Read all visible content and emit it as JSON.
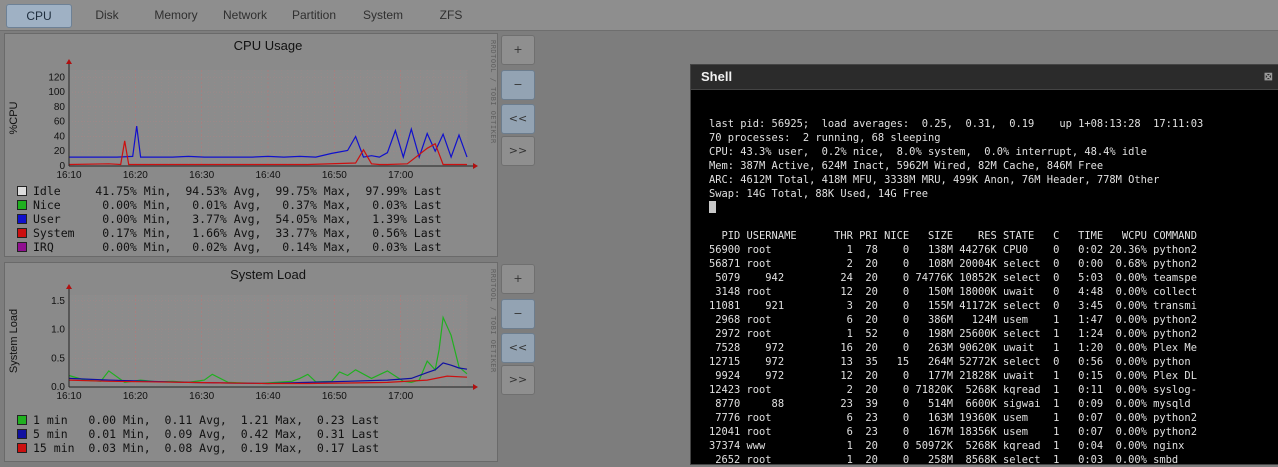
{
  "tabs": [
    {
      "label": "CPU",
      "active": true
    },
    {
      "label": "Disk"
    },
    {
      "label": "Memory"
    },
    {
      "label": "Network"
    },
    {
      "label": "Partition"
    },
    {
      "label": "System"
    },
    {
      "label": "ZFS"
    }
  ],
  "side_tag": "RRDTOOL / TOBI OETIKER",
  "controls": {
    "zoom_in": "+",
    "zoom_out": "−",
    "back": "<<",
    "forward": ">>"
  },
  "cpu_panel": {
    "legend": [
      {
        "name": "Idle",
        "min": "41.75%",
        "avg": "94.53%",
        "max": "99.75%",
        "last": "97.99%",
        "color": "#dcdcdc"
      },
      {
        "name": "Nice",
        "min": "0.00%",
        "avg": "0.01%",
        "max": "0.37%",
        "last": "0.03%",
        "color": "#20b020"
      },
      {
        "name": "User",
        "min": "0.00%",
        "avg": "3.77%",
        "max": "54.05%",
        "last": "1.39%",
        "color": "#1010cc"
      },
      {
        "name": "System",
        "min": "0.17%",
        "avg": "1.66%",
        "max": "33.77%",
        "last": "0.56%",
        "color": "#cc1010"
      },
      {
        "name": "IRQ",
        "min": "0.00%",
        "avg": "0.02%",
        "max": "0.14%",
        "last": "0.03%",
        "color": "#901090"
      }
    ]
  },
  "load_panel": {
    "legend": [
      {
        "name": "1 min",
        "min": "0.00",
        "avg": "0.11",
        "max": "1.21",
        "last": "0.23",
        "color": "#20b020"
      },
      {
        "name": "5 min",
        "min": "0.01",
        "avg": "0.09",
        "max": "0.42",
        "last": "0.31",
        "color": "#1010a0"
      },
      {
        "name": "15 min",
        "min": "0.03",
        "avg": "0.08",
        "max": "0.19",
        "last": "0.17",
        "color": "#cc1010"
      }
    ]
  },
  "legend_labels": {
    "min": "Min,",
    "avg": "Avg,",
    "max": "Max,",
    "last": "Last"
  },
  "chart_data": [
    {
      "type": "line",
      "title": "CPU Usage",
      "ylabel": "%CPU",
      "xlabel": "",
      "ylim": [
        0,
        130
      ],
      "yticks": [
        0,
        20,
        40,
        60,
        80,
        100,
        120
      ],
      "xticks": [
        "16:10",
        "16:20",
        "16:30",
        "16:40",
        "16:50",
        "17:00"
      ],
      "grid": true,
      "legend_position": "bottom",
      "x_range": [
        0,
        1
      ],
      "series": [
        {
          "name": "User",
          "color": "#1010cc",
          "x": [
            0,
            0.04,
            0.08,
            0.12,
            0.16,
            0.17,
            0.18,
            0.22,
            0.26,
            0.3,
            0.34,
            0.38,
            0.42,
            0.46,
            0.5,
            0.54,
            0.58,
            0.62,
            0.66,
            0.7,
            0.72,
            0.74,
            0.76,
            0.78,
            0.8,
            0.82,
            0.84,
            0.86,
            0.88,
            0.9,
            0.92,
            0.94,
            0.96,
            0.98,
            1
          ],
          "values": [
            12,
            12,
            12,
            12,
            13,
            54,
            12,
            12,
            12,
            13,
            12,
            12,
            12,
            12,
            13,
            12,
            13,
            12,
            17,
            21,
            40,
            12,
            14,
            12,
            18,
            48,
            12,
            50,
            12,
            44,
            20,
            43,
            12,
            42,
            12
          ]
        },
        {
          "name": "System",
          "color": "#cc1010",
          "x": [
            0,
            0.1,
            0.13,
            0.14,
            0.15,
            0.3,
            0.5,
            0.6,
            0.72,
            0.74,
            0.76,
            0.78,
            0.8,
            0.85,
            0.9,
            0.92,
            0.94,
            1
          ],
          "values": [
            2,
            3,
            2,
            34,
            2,
            2,
            2,
            2,
            4,
            22,
            3,
            2,
            2,
            3,
            24,
            30,
            2,
            2
          ]
        }
      ]
    },
    {
      "type": "line",
      "title": "System Load",
      "ylabel": "System Load",
      "xlabel": "",
      "ylim": [
        0,
        1.6
      ],
      "yticks": [
        0,
        0.5,
        1.0,
        1.5
      ],
      "ytick_labels": [
        "0.0",
        "0.5",
        "1.0",
        "1.5"
      ],
      "xticks": [
        "16:10",
        "16:20",
        "16:30",
        "16:40",
        "16:50",
        "17:00"
      ],
      "grid": true,
      "legend_position": "bottom",
      "x_range": [
        0,
        1
      ],
      "series": [
        {
          "name": "1 min",
          "color": "#20b020",
          "x": [
            0,
            0.04,
            0.08,
            0.1,
            0.14,
            0.18,
            0.22,
            0.26,
            0.3,
            0.34,
            0.36,
            0.4,
            0.44,
            0.48,
            0.52,
            0.56,
            0.58,
            0.6,
            0.62,
            0.66,
            0.68,
            0.7,
            0.72,
            0.76,
            0.8,
            0.84,
            0.86,
            0.88,
            0.9,
            0.92,
            0.93,
            0.94,
            0.96,
            0.98,
            1
          ],
          "values": [
            0.2,
            0.12,
            0.1,
            0.28,
            0.08,
            0.12,
            0.09,
            0.1,
            0.08,
            0.12,
            0.22,
            0.08,
            0.07,
            0.06,
            0.08,
            0.1,
            0.15,
            0.22,
            0.09,
            0.1,
            0.26,
            0.2,
            0.3,
            0.15,
            0.28,
            0.1,
            0.08,
            0.12,
            0.45,
            0.3,
            0.65,
            1.21,
            0.9,
            0.35,
            0.23
          ]
        },
        {
          "name": "5 min",
          "color": "#1010a0",
          "x": [
            0,
            0.1,
            0.2,
            0.3,
            0.4,
            0.5,
            0.6,
            0.7,
            0.8,
            0.86,
            0.9,
            0.92,
            0.94,
            0.96,
            0.98,
            1
          ],
          "values": [
            0.15,
            0.12,
            0.1,
            0.08,
            0.07,
            0.06,
            0.08,
            0.1,
            0.12,
            0.15,
            0.25,
            0.3,
            0.42,
            0.38,
            0.33,
            0.31
          ]
        },
        {
          "name": "15 min",
          "color": "#cc1010",
          "x": [
            0,
            0.1,
            0.2,
            0.3,
            0.4,
            0.5,
            0.6,
            0.7,
            0.8,
            0.9,
            0.95,
            1
          ],
          "values": [
            0.12,
            0.1,
            0.09,
            0.08,
            0.07,
            0.06,
            0.06,
            0.07,
            0.08,
            0.12,
            0.19,
            0.17
          ]
        }
      ]
    }
  ],
  "shell": {
    "title": "Shell",
    "close_icon": "⊠",
    "lines": [
      "last pid: 56925;  load averages:  0.25,  0.31,  0.19    up 1+08:13:28  17:11:03",
      "70 processes:  2 running, 68 sleeping",
      "CPU: 43.3% user,  0.2% nice,  8.0% system,  0.0% interrupt, 48.4% idle",
      "Mem: 387M Active, 624M Inact, 5962M Wired, 82M Cache, 846M Free",
      "ARC: 4612M Total, 418M MFU, 3338M MRU, 499K Anon, 76M Header, 778M Other",
      "Swap: 14G Total, 88K Used, 14G Free"
    ],
    "header": "  PID USERNAME      THR PRI NICE   SIZE    RES STATE   C   TIME   WCPU COMMAND",
    "processes": [
      "56900 root            1  78    0   138M 44276K CPU0    0   0:02 20.36% python2",
      "56871 root            2  20    0   108M 20004K select  0   0:00  0.68% python2",
      " 5079    942         24  20    0 74776K 10852K select  0   5:03  0.00% teamspe",
      " 3148 root           12  20    0   150M 18000K uwait   0   4:48  0.00% collect",
      "11081    921          3  20    0   155M 41172K select  0   3:45  0.00% transmi",
      " 2968 root            6  20    0   386M   124M usem    1   1:47  0.00% python2",
      " 2972 root            1  52    0   198M 25600K select  1   1:24  0.00% python2",
      " 7528    972         16  20    0   263M 90620K uwait   1   1:20  0.00% Plex Me",
      "12715    972         13  35   15   264M 52772K select  0   0:56  0.00% python",
      " 9924    972         12  20    0   177M 21828K uwait   1   0:15  0.00% Plex DL",
      "12423 root            2  20    0 71820K  5268K kqread  1   0:11  0.00% syslog-",
      " 8770     88         23  39    0   514M  6600K sigwai  1   0:09  0.00% mysqld",
      " 7776 root            6  23    0   163M 19360K usem    1   0:07  0.00% python2",
      "12041 root            6  23    0   167M 18356K usem    1   0:07  0.00% python2",
      "37374 www             1  20    0 50972K  5268K kqread  1   0:04  0.00% nginx",
      " 2652 root            1  20    0   258M  8568K select  1   0:03  0.00% smbd"
    ]
  }
}
